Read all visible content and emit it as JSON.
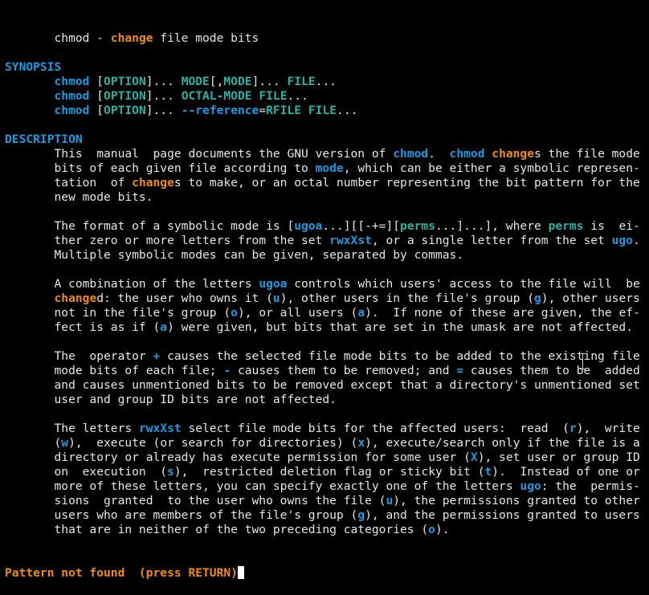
{
  "lines": [
    [
      {
        "t": "       chmod - "
      },
      {
        "t": "change",
        "s": "o"
      },
      {
        "t": " file mode bits"
      }
    ],
    [],
    [
      {
        "t": "SYNOPSIS",
        "s": "hdr"
      }
    ],
    [
      {
        "t": "       "
      },
      {
        "t": "chmod",
        "s": "b"
      },
      {
        "t": " ["
      },
      {
        "t": "OPTION",
        "s": "c"
      },
      {
        "t": "]... "
      },
      {
        "t": "MODE",
        "s": "c"
      },
      {
        "t": "[,"
      },
      {
        "t": "MODE",
        "s": "c"
      },
      {
        "t": "]... "
      },
      {
        "t": "FILE",
        "s": "c"
      },
      {
        "t": "..."
      }
    ],
    [
      {
        "t": "       "
      },
      {
        "t": "chmod",
        "s": "b"
      },
      {
        "t": " ["
      },
      {
        "t": "OPTION",
        "s": "c"
      },
      {
        "t": "]... "
      },
      {
        "t": "OCTAL-MODE",
        "s": "c"
      },
      {
        "t": " "
      },
      {
        "t": "FILE",
        "s": "c"
      },
      {
        "t": "..."
      }
    ],
    [
      {
        "t": "       "
      },
      {
        "t": "chmod",
        "s": "b"
      },
      {
        "t": " ["
      },
      {
        "t": "OPTION",
        "s": "c"
      },
      {
        "t": "]... "
      },
      {
        "t": "--reference",
        "s": "b"
      },
      {
        "t": "="
      },
      {
        "t": "RFILE",
        "s": "c"
      },
      {
        "t": " "
      },
      {
        "t": "FILE",
        "s": "c"
      },
      {
        "t": "..."
      }
    ],
    [],
    [
      {
        "t": "DESCRIPTION",
        "s": "hdr"
      }
    ],
    [
      {
        "t": "       This  manual  page documents the GNU version of "
      },
      {
        "t": "chmod",
        "s": "b"
      },
      {
        "t": ".  "
      },
      {
        "t": "chmod",
        "s": "b"
      },
      {
        "t": " "
      },
      {
        "t": "change",
        "s": "o"
      },
      {
        "t": "s the file mode"
      }
    ],
    [
      {
        "t": "       bits of each given file according to "
      },
      {
        "t": "mode",
        "s": "b"
      },
      {
        "t": ", which can be either a symbolic represen-"
      }
    ],
    [
      {
        "t": "       tation  of "
      },
      {
        "t": "change",
        "s": "o"
      },
      {
        "t": "s to make, or an octal number representing the bit pattern for the"
      }
    ],
    [
      {
        "t": "       new mode bits."
      }
    ],
    [],
    [
      {
        "t": "       The format of a symbolic mode is ["
      },
      {
        "t": "ugoa",
        "s": "b"
      },
      {
        "t": "...][[-+=]["
      },
      {
        "t": "perms",
        "s": "c"
      },
      {
        "t": "...]...], where "
      },
      {
        "t": "perms",
        "s": "c"
      },
      {
        "t": " is  ei-"
      }
    ],
    [
      {
        "t": "       ther zero or more letters from the set "
      },
      {
        "t": "rwxXst",
        "s": "b"
      },
      {
        "t": ", or a single letter from the set "
      },
      {
        "t": "ugo",
        "s": "b"
      },
      {
        "t": "."
      }
    ],
    [
      {
        "t": "       Multiple symbolic modes can be given, separated by commas."
      }
    ],
    [],
    [
      {
        "t": "       A combination of the letters "
      },
      {
        "t": "ugoa",
        "s": "b"
      },
      {
        "t": " controls which users' access to the file will  be"
      }
    ],
    [
      {
        "t": "       "
      },
      {
        "t": "change",
        "s": "o"
      },
      {
        "t": "d: the user who owns it ("
      },
      {
        "t": "u",
        "s": "b"
      },
      {
        "t": "), other users in the file's group ("
      },
      {
        "t": "g",
        "s": "b"
      },
      {
        "t": "), other users"
      }
    ],
    [
      {
        "t": "       not in the file's group ("
      },
      {
        "t": "o",
        "s": "b"
      },
      {
        "t": "), or all users ("
      },
      {
        "t": "a",
        "s": "b"
      },
      {
        "t": ").  If none of these are given, the ef-"
      }
    ],
    [
      {
        "t": "       fect is as if ("
      },
      {
        "t": "a",
        "s": "b"
      },
      {
        "t": ") were given, but bits that are set in the umask are not affected."
      }
    ],
    [],
    [
      {
        "t": "       The  operator "
      },
      {
        "t": "+",
        "s": "b"
      },
      {
        "t": " causes the selected file mode bits to be added to the existing file"
      }
    ],
    [
      {
        "t": "       mode bits of each file; "
      },
      {
        "t": "-",
        "s": "b"
      },
      {
        "t": " causes them to be removed; and "
      },
      {
        "t": "=",
        "s": "b"
      },
      {
        "t": " causes them to be  added"
      }
    ],
    [
      {
        "t": "       and causes unmentioned bits to be removed except that a directory's unmentioned set"
      }
    ],
    [
      {
        "t": "       user and group ID bits are not affected."
      }
    ],
    [],
    [
      {
        "t": "       The letters "
      },
      {
        "t": "rwxXst",
        "s": "b"
      },
      {
        "t": " select file mode bits for the affected users:  read  ("
      },
      {
        "t": "r",
        "s": "b"
      },
      {
        "t": "),  write"
      }
    ],
    [
      {
        "t": "       ("
      },
      {
        "t": "w",
        "s": "b"
      },
      {
        "t": "),  execute (or search for directories) ("
      },
      {
        "t": "x",
        "s": "b"
      },
      {
        "t": "), execute/search only if the file is a"
      }
    ],
    [
      {
        "t": "       directory or already has execute permission for some user ("
      },
      {
        "t": "X",
        "s": "b"
      },
      {
        "t": "), set user or group ID"
      }
    ],
    [
      {
        "t": "       on  execution  ("
      },
      {
        "t": "s",
        "s": "b"
      },
      {
        "t": "),  restricted deletion flag or sticky bit ("
      },
      {
        "t": "t",
        "s": "b"
      },
      {
        "t": ").  Instead of one or"
      }
    ],
    [
      {
        "t": "       more of these letters, you can specify exactly one of the letters "
      },
      {
        "t": "ugo",
        "s": "b"
      },
      {
        "t": ": the  permis-"
      }
    ],
    [
      {
        "t": "       sions  granted  to the user who owns the file ("
      },
      {
        "t": "u",
        "s": "b"
      },
      {
        "t": "), the permissions granted to other"
      }
    ],
    [
      {
        "t": "       users who are members of the file's group ("
      },
      {
        "t": "g",
        "s": "b"
      },
      {
        "t": "), and the permissions granted to users"
      }
    ],
    [
      {
        "t": "       that are in neither of the two preceding categories ("
      },
      {
        "t": "o",
        "s": "b"
      },
      {
        "t": ")."
      }
    ]
  ],
  "status": {
    "message": "Pattern not found  (press RETURN)"
  },
  "colors": {
    "background": "#000000",
    "text": "#e6e6e6",
    "bold_blue": "#1a9be2",
    "cyan": "#27b3a6",
    "orange": "#f08c12"
  }
}
